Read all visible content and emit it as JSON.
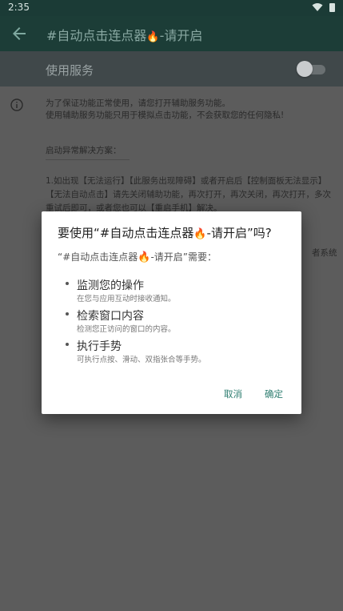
{
  "status": {
    "time": "2:35",
    "wifi_icon": "wifi-icon",
    "battery_icon": "battery-icon"
  },
  "appbar": {
    "back_icon": "arrow-back-icon",
    "title_part1": "#自动点击连点器",
    "title_part2": "-请开启",
    "fire_icon": "🔥"
  },
  "service": {
    "label": "使用服务",
    "enabled": false
  },
  "info": {
    "icon": "info-icon",
    "note_line1": "为了保证功能正常使用，请您打开辅助服务功能。",
    "note_line2": "使用辅助服务功能只用于模拟点击功能，不会获取您的任何隐私!",
    "trouble_title": "启动异常解决方案：",
    "long_text": "1.如出现【无法运行】【此服务出现障碍】或者开启后【控制面板无法显示】【无法自动点击】请先关闭辅助功能，再次打开，再次关闭，再次打开，多次重试后即可，或者您也可以【重启手机】解决。",
    "side_text": "者系统"
  },
  "dialog": {
    "title_prefix": "要使用“#自动点击连点器",
    "title_suffix": "-请开启”吗?",
    "subtitle_prefix": "“#自动点击连点器",
    "subtitle_suffix": "-请开启”需要：",
    "fire_icon": "🔥",
    "permissions": [
      {
        "title": "监测您的操作",
        "desc": "在您与应用互动时接收通知。"
      },
      {
        "title": "检索窗口内容",
        "desc": "检测您正访问的窗口的内容。"
      },
      {
        "title": "执行手势",
        "desc": "可执行点按、滑动、双指张合等手势。"
      }
    ],
    "cancel": "取消",
    "confirm": "确定"
  },
  "colors": {
    "accent": "#2e7d70",
    "appbar": "#1c3d37",
    "scrim": "#5c5c5c"
  }
}
